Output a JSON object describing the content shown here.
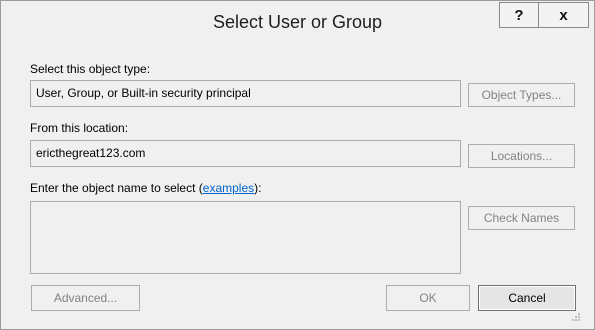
{
  "window": {
    "title": "Select User or Group",
    "help_glyph": "?",
    "close_glyph": "x"
  },
  "object_type": {
    "label": "Select this object type:",
    "value": "User, Group, or Built-in security principal",
    "button": "Object Types..."
  },
  "location": {
    "label": "From this location:",
    "value": "ericthegreat123.com",
    "button": "Locations..."
  },
  "object_name": {
    "label_prefix": "Enter the object name to select (",
    "label_link": "examples",
    "label_suffix": "):",
    "value": "",
    "check_button": "Check Names"
  },
  "footer": {
    "advanced": "Advanced...",
    "ok": "OK",
    "cancel": "Cancel"
  },
  "icons": {
    "help": "help-icon",
    "close": "close-icon",
    "resize": "resize-grip-icon"
  }
}
